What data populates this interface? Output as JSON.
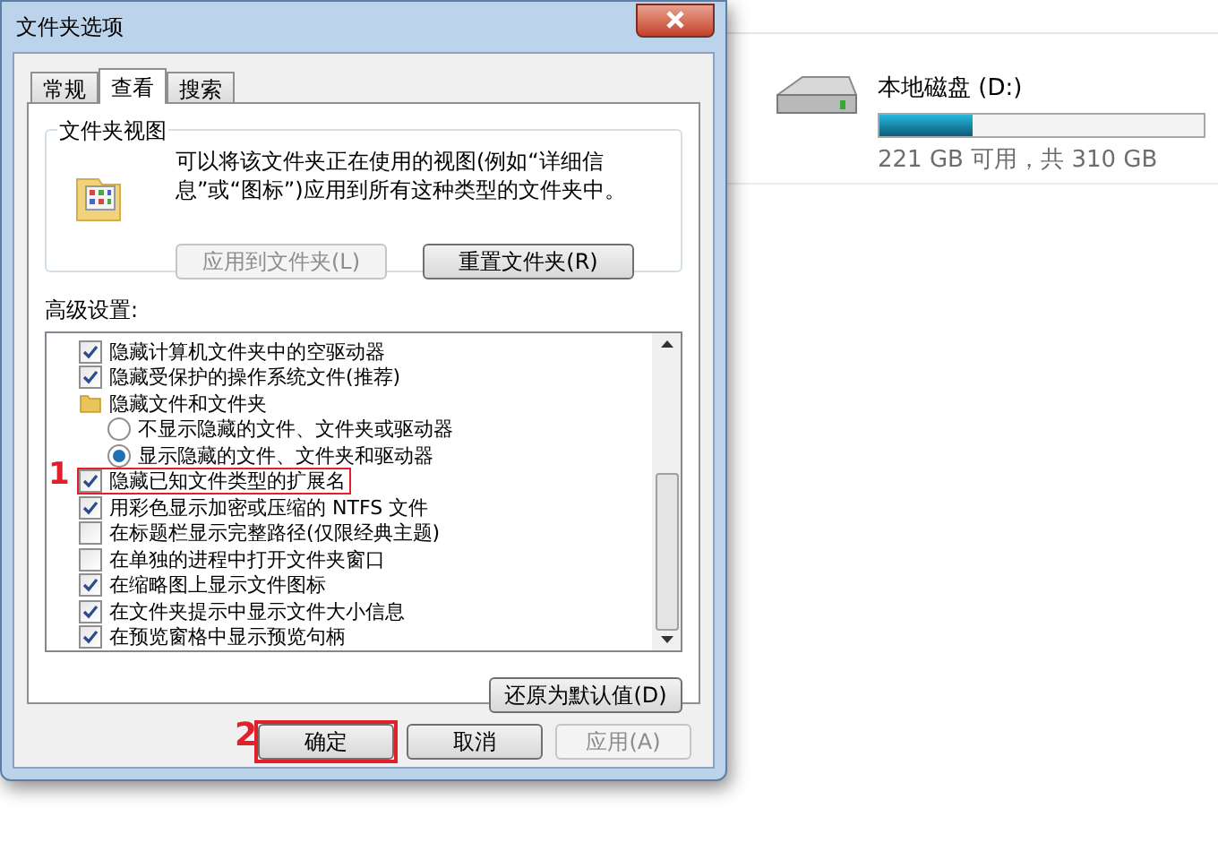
{
  "window": {
    "title": "文件夹选项"
  },
  "tabs": [
    {
      "label": "常规",
      "selected": false
    },
    {
      "label": "查看",
      "selected": true
    },
    {
      "label": "搜索",
      "selected": false
    }
  ],
  "folder_views": {
    "title": "文件夹视图",
    "description": "可以将该文件夹正在使用的视图(例如“详细信息”或“图标”)应用到所有这种类型的文件夹中。",
    "buttons": [
      {
        "label": "应用到文件夹(L)",
        "disabled": true
      },
      {
        "label": "重置文件夹(R)",
        "disabled": false
      }
    ]
  },
  "advanced": {
    "title": "高级设置:",
    "items": [
      {
        "kind": "checkbox",
        "label": "隐藏计算机文件夹中的空驱动器",
        "checked": true,
        "highlighted": false
      },
      {
        "kind": "checkbox",
        "label": "隐藏受保护的操作系统文件(推荐)",
        "checked": true,
        "highlighted": false
      },
      {
        "kind": "folder",
        "label": "隐藏文件和文件夹",
        "children": [
          {
            "kind": "radio",
            "label": "不显示隐藏的文件、文件夹或驱动器",
            "selected": false
          },
          {
            "kind": "radio",
            "label": "显示隐藏的文件、文件夹和驱动器",
            "selected": true
          }
        ]
      },
      {
        "kind": "checkbox",
        "label": "隐藏已知文件类型的扩展名",
        "checked": true,
        "highlighted": true,
        "annotation": "1"
      },
      {
        "kind": "checkbox",
        "label": "用彩色显示加密或压缩的 NTFS 文件",
        "checked": true,
        "highlighted": false
      },
      {
        "kind": "checkbox",
        "label": "在标题栏显示完整路径(仅限经典主题)",
        "checked": false,
        "highlighted": false
      },
      {
        "kind": "checkbox",
        "label": "在单独的进程中打开文件夹窗口",
        "checked": false,
        "highlighted": false
      },
      {
        "kind": "checkbox",
        "label": "在缩略图上显示文件图标",
        "checked": true,
        "highlighted": false
      },
      {
        "kind": "checkbox",
        "label": "在文件夹提示中显示文件大小信息",
        "checked": true,
        "highlighted": false
      },
      {
        "kind": "checkbox",
        "label": "在预览窗格中显示预览句柄",
        "checked": true,
        "highlighted": false
      }
    ],
    "restore_button": "还原为默认值(D)"
  },
  "dialog_buttons": [
    {
      "label": "确定",
      "disabled": false,
      "highlighted": true,
      "annotation": "2"
    },
    {
      "label": "取消",
      "disabled": false,
      "highlighted": false
    },
    {
      "label": "应用(A)",
      "disabled": true,
      "highlighted": false
    }
  ],
  "drive": {
    "name": "本地磁盘 (D:)",
    "level": 0.29,
    "free_text": "221 GB 可用，共 310 GB"
  }
}
